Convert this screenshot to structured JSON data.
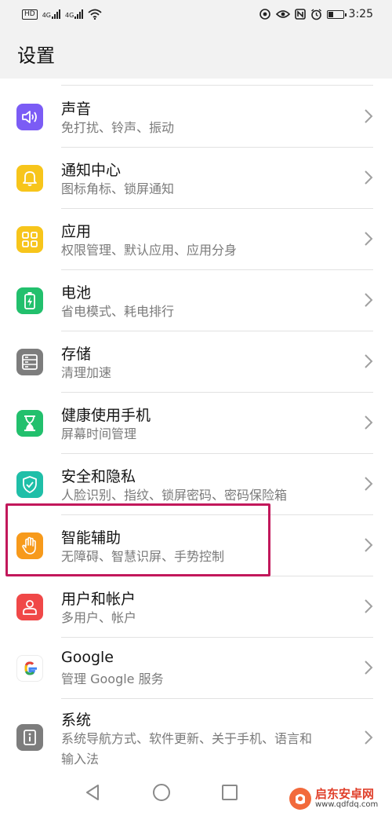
{
  "status_bar": {
    "hd": "HD",
    "sim1_type": "4G",
    "sim2_type": "4G",
    "time": "3:25",
    "icons": [
      "eye-icon",
      "nfc-icon",
      "alarm-icon",
      "battery-icon",
      "wifi-icon"
    ]
  },
  "header": {
    "title": "设置"
  },
  "items": [
    {
      "title": "声音",
      "subtitle": "免打扰、铃声、振动",
      "icon": "speaker-icon",
      "color": "#7b5cf5"
    },
    {
      "title": "通知中心",
      "subtitle": "图标角标、锁屏通知",
      "icon": "bell-icon",
      "color": "#f7c51b"
    },
    {
      "title": "应用",
      "subtitle": "权限管理、默认应用、应用分身",
      "icon": "apps-grid-icon",
      "color": "#f7c51b"
    },
    {
      "title": "电池",
      "subtitle": "省电模式、耗电排行",
      "icon": "battery-charge-icon",
      "color": "#22c06d"
    },
    {
      "title": "存储",
      "subtitle": "清理加速",
      "icon": "storage-icon",
      "color": "#7d7d7d"
    },
    {
      "title": "健康使用手机",
      "subtitle": "屏幕时间管理",
      "icon": "hourglass-icon",
      "color": "#22c06d"
    },
    {
      "title": "安全和隐私",
      "subtitle": "人脸识别、指纹、锁屏密码、密码保险箱",
      "icon": "shield-icon",
      "color": "#1fbfa8"
    },
    {
      "title": "智能辅助",
      "subtitle": "无障碍、智慧识屏、手势控制",
      "icon": "hand-icon",
      "color": "#f79a1b"
    },
    {
      "title": "用户和帐户",
      "subtitle": "多用户、帐户",
      "icon": "user-icon",
      "color": "#f04848"
    },
    {
      "title": "Google",
      "subtitle": "管理 Google 服务",
      "icon": "google-icon",
      "color": "#ffffff"
    },
    {
      "title": "系统",
      "subtitle_line1": "系统导航方式、软件更新、关于手机、语言和",
      "subtitle_line2": "输入法",
      "icon": "system-info-icon",
      "color": "#7d7d7d"
    }
  ],
  "highlight_color": "#c2185b",
  "navbar": {
    "buttons": [
      "back-icon",
      "home-icon",
      "recents-icon"
    ]
  },
  "watermark": {
    "line1": "启东安卓网",
    "line2": "www.qdfdq.com"
  }
}
